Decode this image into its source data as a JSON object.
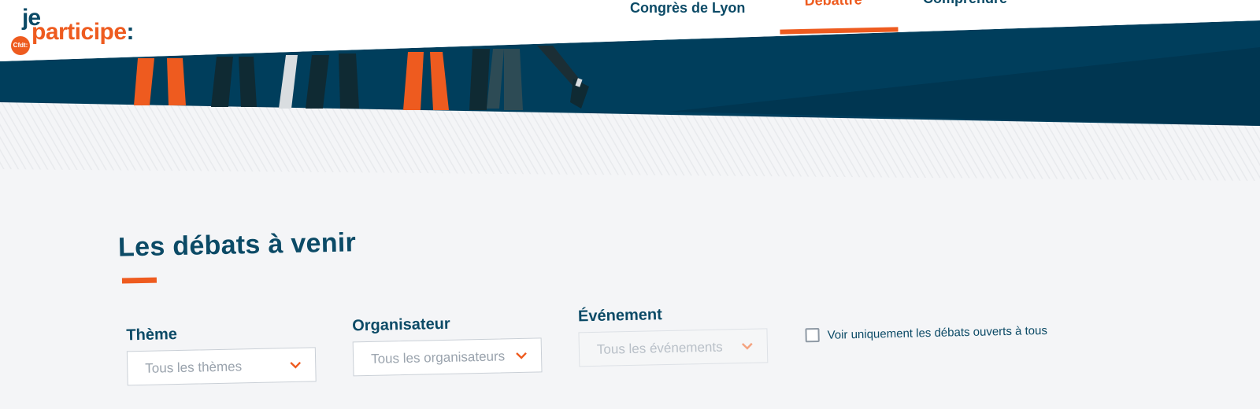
{
  "logo": {
    "je": "je",
    "participe": "participe",
    "colon": ":",
    "badge": "Cfdt:"
  },
  "nav": {
    "items": [
      {
        "label": "Congrès de Lyon"
      },
      {
        "label": "Débattre"
      },
      {
        "label": "Comprendre"
      }
    ],
    "active_index": 1
  },
  "main": {
    "title": "Les débats à venir",
    "filters": [
      {
        "label": "Thème",
        "value": "Tous les thèmes",
        "disabled": false
      },
      {
        "label": "Organisateur",
        "value": "Tous les organisateurs",
        "disabled": false
      },
      {
        "label": "Événement",
        "value": "Tous les événements",
        "disabled": true
      }
    ],
    "checkbox_label": "Voir uniquement les débats ouverts à tous",
    "checkbox_checked": false
  },
  "colors": {
    "brand_blue": "#0b4a66",
    "brand_orange": "#ee5b1f",
    "banner_dark": "#003e5c",
    "background": "#f4f5f7"
  },
  "icons": {
    "select_chevron": "chevron-down-icon",
    "checkbox": "checkbox-icon"
  }
}
